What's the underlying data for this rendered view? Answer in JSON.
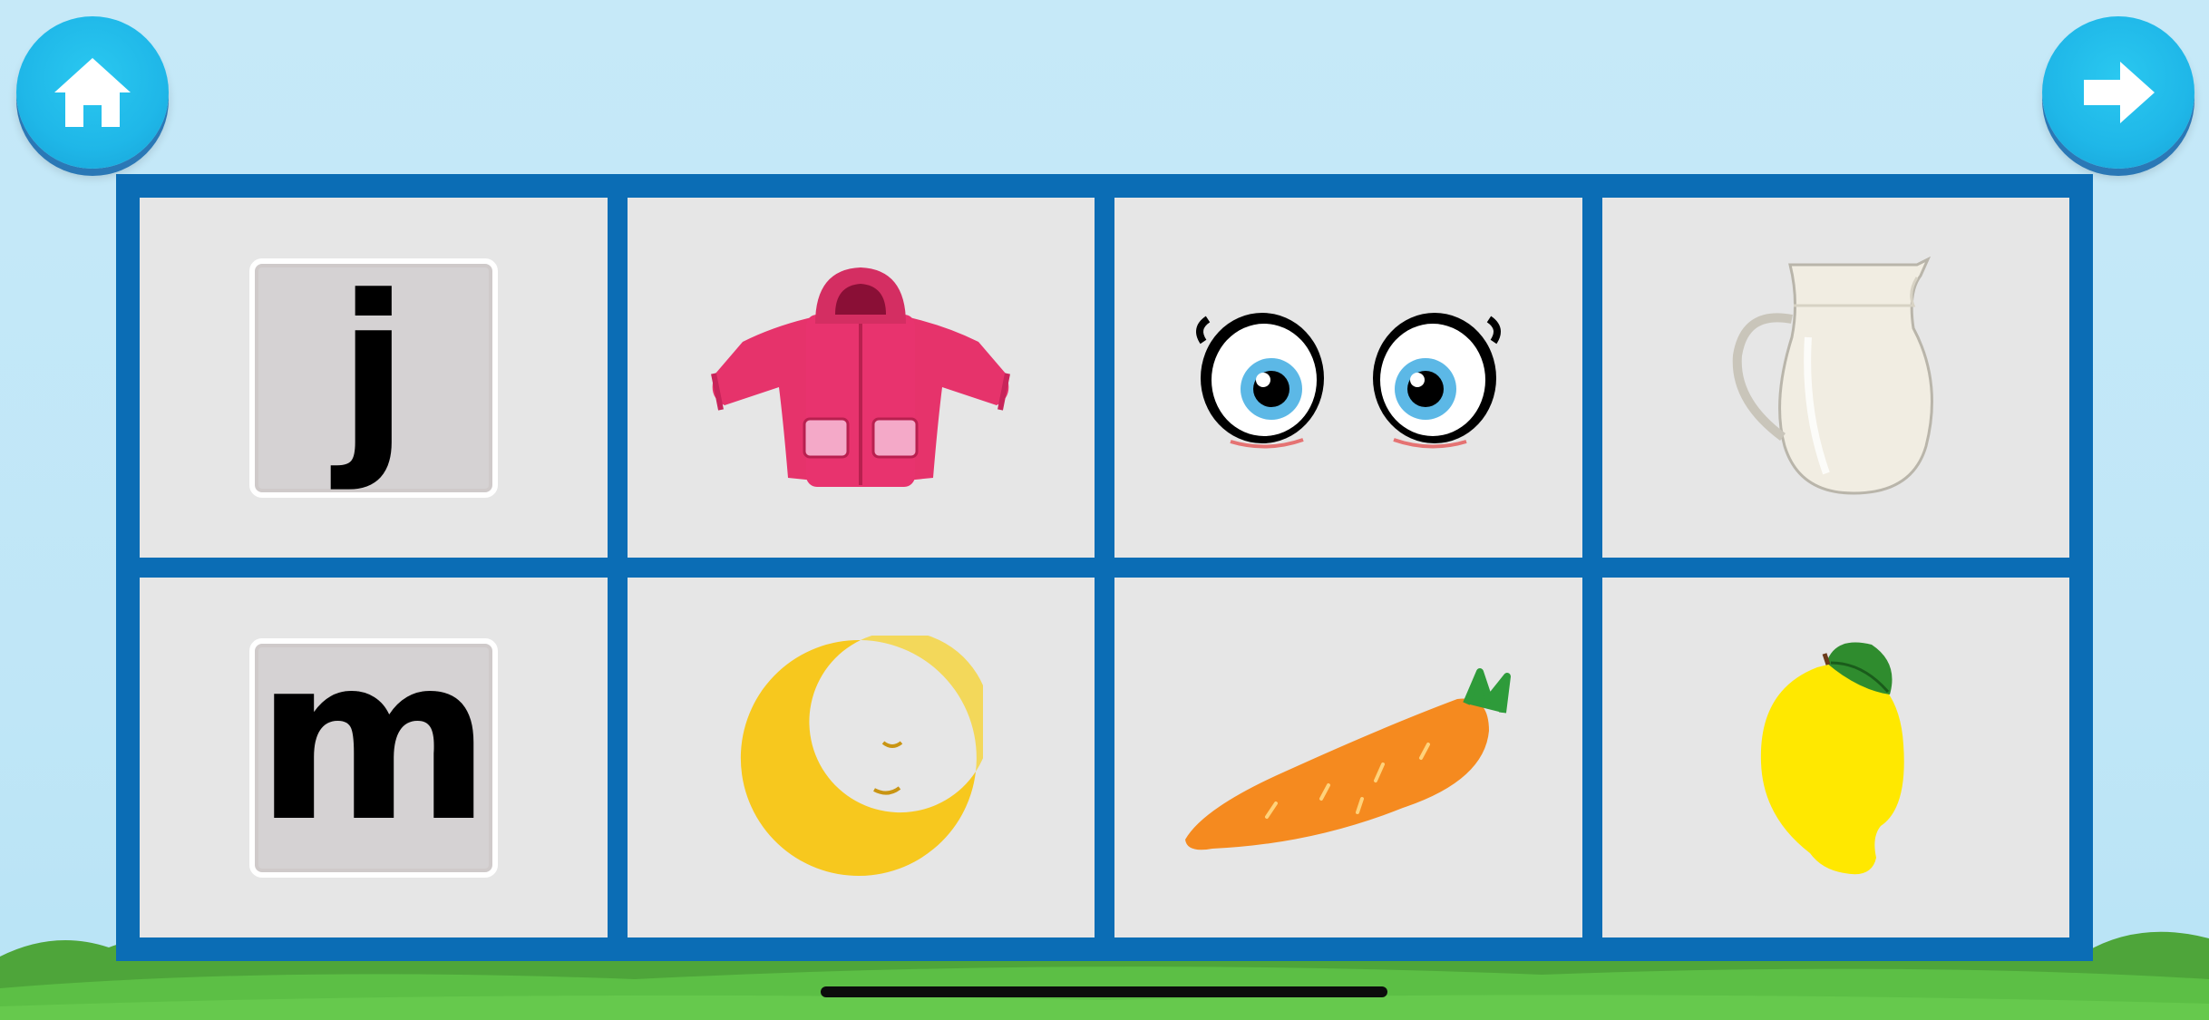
{
  "nav": {
    "home_icon": "home-icon",
    "next_icon": "arrow-right-icon"
  },
  "colors": {
    "button": "#1fb7e8",
    "board": "#0b6db5",
    "cell": "#e6e6e6"
  },
  "board": {
    "rows": [
      [
        {
          "type": "letter",
          "text": "j"
        },
        {
          "type": "picture",
          "icon": "jacket-icon"
        },
        {
          "type": "picture",
          "icon": "eyes-icon"
        },
        {
          "type": "picture",
          "icon": "milk-jug-icon"
        }
      ],
      [
        {
          "type": "letter",
          "text": "m"
        },
        {
          "type": "picture",
          "icon": "moon-icon"
        },
        {
          "type": "picture",
          "icon": "carrot-icon"
        },
        {
          "type": "picture",
          "icon": "mango-icon"
        }
      ]
    ]
  }
}
